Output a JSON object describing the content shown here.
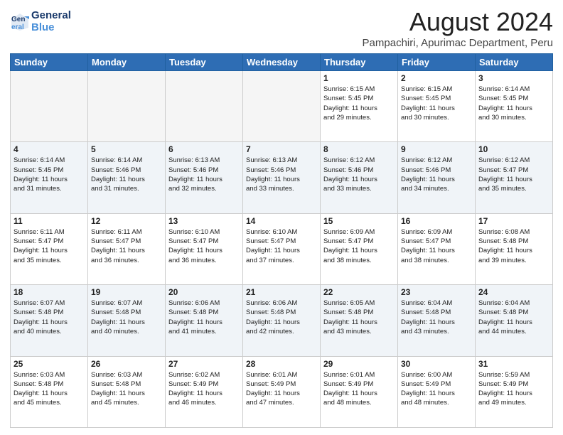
{
  "header": {
    "logo_line1": "General",
    "logo_line2": "Blue",
    "title": "August 2024",
    "subtitle": "Pampachiri, Apurimac Department, Peru"
  },
  "days_of_week": [
    "Sunday",
    "Monday",
    "Tuesday",
    "Wednesday",
    "Thursday",
    "Friday",
    "Saturday"
  ],
  "weeks": [
    [
      {
        "day": "",
        "info": ""
      },
      {
        "day": "",
        "info": ""
      },
      {
        "day": "",
        "info": ""
      },
      {
        "day": "",
        "info": ""
      },
      {
        "day": "1",
        "info": "Sunrise: 6:15 AM\nSunset: 5:45 PM\nDaylight: 11 hours\nand 29 minutes."
      },
      {
        "day": "2",
        "info": "Sunrise: 6:15 AM\nSunset: 5:45 PM\nDaylight: 11 hours\nand 30 minutes."
      },
      {
        "day": "3",
        "info": "Sunrise: 6:14 AM\nSunset: 5:45 PM\nDaylight: 11 hours\nand 30 minutes."
      }
    ],
    [
      {
        "day": "4",
        "info": "Sunrise: 6:14 AM\nSunset: 5:45 PM\nDaylight: 11 hours\nand 31 minutes."
      },
      {
        "day": "5",
        "info": "Sunrise: 6:14 AM\nSunset: 5:46 PM\nDaylight: 11 hours\nand 31 minutes."
      },
      {
        "day": "6",
        "info": "Sunrise: 6:13 AM\nSunset: 5:46 PM\nDaylight: 11 hours\nand 32 minutes."
      },
      {
        "day": "7",
        "info": "Sunrise: 6:13 AM\nSunset: 5:46 PM\nDaylight: 11 hours\nand 33 minutes."
      },
      {
        "day": "8",
        "info": "Sunrise: 6:12 AM\nSunset: 5:46 PM\nDaylight: 11 hours\nand 33 minutes."
      },
      {
        "day": "9",
        "info": "Sunrise: 6:12 AM\nSunset: 5:46 PM\nDaylight: 11 hours\nand 34 minutes."
      },
      {
        "day": "10",
        "info": "Sunrise: 6:12 AM\nSunset: 5:47 PM\nDaylight: 11 hours\nand 35 minutes."
      }
    ],
    [
      {
        "day": "11",
        "info": "Sunrise: 6:11 AM\nSunset: 5:47 PM\nDaylight: 11 hours\nand 35 minutes."
      },
      {
        "day": "12",
        "info": "Sunrise: 6:11 AM\nSunset: 5:47 PM\nDaylight: 11 hours\nand 36 minutes."
      },
      {
        "day": "13",
        "info": "Sunrise: 6:10 AM\nSunset: 5:47 PM\nDaylight: 11 hours\nand 36 minutes."
      },
      {
        "day": "14",
        "info": "Sunrise: 6:10 AM\nSunset: 5:47 PM\nDaylight: 11 hours\nand 37 minutes."
      },
      {
        "day": "15",
        "info": "Sunrise: 6:09 AM\nSunset: 5:47 PM\nDaylight: 11 hours\nand 38 minutes."
      },
      {
        "day": "16",
        "info": "Sunrise: 6:09 AM\nSunset: 5:47 PM\nDaylight: 11 hours\nand 38 minutes."
      },
      {
        "day": "17",
        "info": "Sunrise: 6:08 AM\nSunset: 5:48 PM\nDaylight: 11 hours\nand 39 minutes."
      }
    ],
    [
      {
        "day": "18",
        "info": "Sunrise: 6:07 AM\nSunset: 5:48 PM\nDaylight: 11 hours\nand 40 minutes."
      },
      {
        "day": "19",
        "info": "Sunrise: 6:07 AM\nSunset: 5:48 PM\nDaylight: 11 hours\nand 40 minutes."
      },
      {
        "day": "20",
        "info": "Sunrise: 6:06 AM\nSunset: 5:48 PM\nDaylight: 11 hours\nand 41 minutes."
      },
      {
        "day": "21",
        "info": "Sunrise: 6:06 AM\nSunset: 5:48 PM\nDaylight: 11 hours\nand 42 minutes."
      },
      {
        "day": "22",
        "info": "Sunrise: 6:05 AM\nSunset: 5:48 PM\nDaylight: 11 hours\nand 43 minutes."
      },
      {
        "day": "23",
        "info": "Sunrise: 6:04 AM\nSunset: 5:48 PM\nDaylight: 11 hours\nand 43 minutes."
      },
      {
        "day": "24",
        "info": "Sunrise: 6:04 AM\nSunset: 5:48 PM\nDaylight: 11 hours\nand 44 minutes."
      }
    ],
    [
      {
        "day": "25",
        "info": "Sunrise: 6:03 AM\nSunset: 5:48 PM\nDaylight: 11 hours\nand 45 minutes."
      },
      {
        "day": "26",
        "info": "Sunrise: 6:03 AM\nSunset: 5:48 PM\nDaylight: 11 hours\nand 45 minutes."
      },
      {
        "day": "27",
        "info": "Sunrise: 6:02 AM\nSunset: 5:49 PM\nDaylight: 11 hours\nand 46 minutes."
      },
      {
        "day": "28",
        "info": "Sunrise: 6:01 AM\nSunset: 5:49 PM\nDaylight: 11 hours\nand 47 minutes."
      },
      {
        "day": "29",
        "info": "Sunrise: 6:01 AM\nSunset: 5:49 PM\nDaylight: 11 hours\nand 48 minutes."
      },
      {
        "day": "30",
        "info": "Sunrise: 6:00 AM\nSunset: 5:49 PM\nDaylight: 11 hours\nand 48 minutes."
      },
      {
        "day": "31",
        "info": "Sunrise: 5:59 AM\nSunset: 5:49 PM\nDaylight: 11 hours\nand 49 minutes."
      }
    ]
  ]
}
